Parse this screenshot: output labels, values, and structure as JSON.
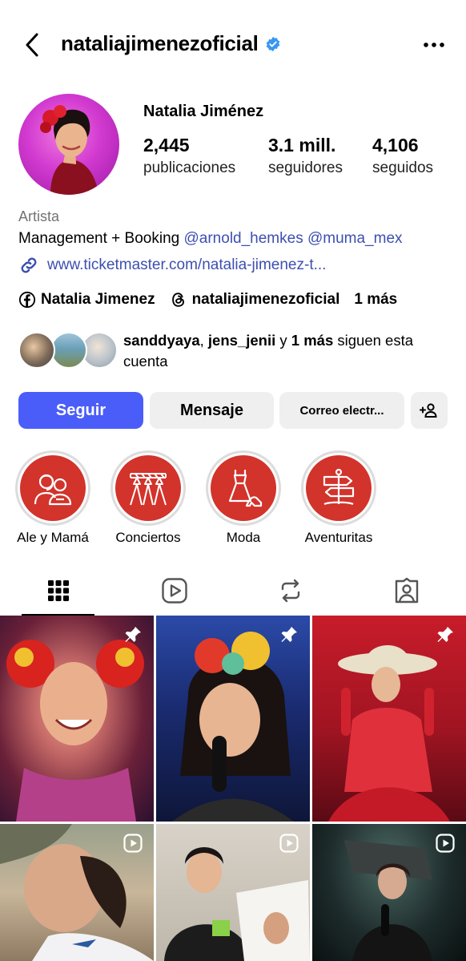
{
  "header": {
    "username": "nataliajimenezoficial",
    "back_icon": "chevron-left-icon",
    "verified_icon": "verified-badge-icon",
    "more_icon": "more-horizontal-icon"
  },
  "profile": {
    "full_name": "Natalia Jiménez",
    "stats": [
      {
        "value": "2,445",
        "label": "publicaciones"
      },
      {
        "value": "3.1 mill.",
        "label": "seguidores"
      },
      {
        "value": "4,106",
        "label": "seguidos"
      }
    ],
    "category": "Artista",
    "bio_text": "Management +  Booking ",
    "bio_mentions": [
      "@arnold_hemkes",
      "@muma_mex"
    ],
    "link": "www.ticketmaster.com/natalia-jimenez-t...",
    "social": [
      {
        "icon": "facebook-icon",
        "label": "Natalia Jimenez"
      },
      {
        "icon": "threads-icon",
        "label": "nataliajimenezoficial"
      },
      {
        "icon": "",
        "label": "1 más"
      }
    ]
  },
  "followed_by": {
    "names": [
      "sanddyaya",
      "jens_jenii"
    ],
    "sep": ", ",
    "conj": " y ",
    "more": "1 más",
    "suffix": " siguen esta cuenta"
  },
  "actions": {
    "follow": "Seguir",
    "message": "Mensaje",
    "email": "Correo electr...",
    "add_user_icon": "person-add-icon"
  },
  "highlights": [
    {
      "label": "Ale y Mamá",
      "icon": "family-icon"
    },
    {
      "label": "Conciertos",
      "icon": "concert-stage-icon"
    },
    {
      "label": "Moda",
      "icon": "dress-shoe-icon"
    },
    {
      "label": "Aventuritas",
      "icon": "signpost-icon"
    }
  ],
  "tabs": [
    {
      "icon": "grid-icon",
      "active": true
    },
    {
      "icon": "reels-icon",
      "active": false
    },
    {
      "icon": "reposts-icon",
      "active": false
    },
    {
      "icon": "tagged-icon",
      "active": false
    }
  ],
  "posts": [
    {
      "kind": "pinned",
      "icon": "pin-icon"
    },
    {
      "kind": "pinned",
      "icon": "pin-icon"
    },
    {
      "kind": "pinned",
      "icon": "pin-icon"
    },
    {
      "kind": "reel",
      "icon": "reel-play-icon"
    },
    {
      "kind": "reel",
      "icon": "reel-play-icon"
    },
    {
      "kind": "reel",
      "icon": "reel-play-icon"
    }
  ],
  "colors": {
    "primary_button": "#4a5df9",
    "link": "#3d4fb0",
    "highlight_disc": "#d2332b",
    "avatar_bg": "#d23ad0"
  }
}
